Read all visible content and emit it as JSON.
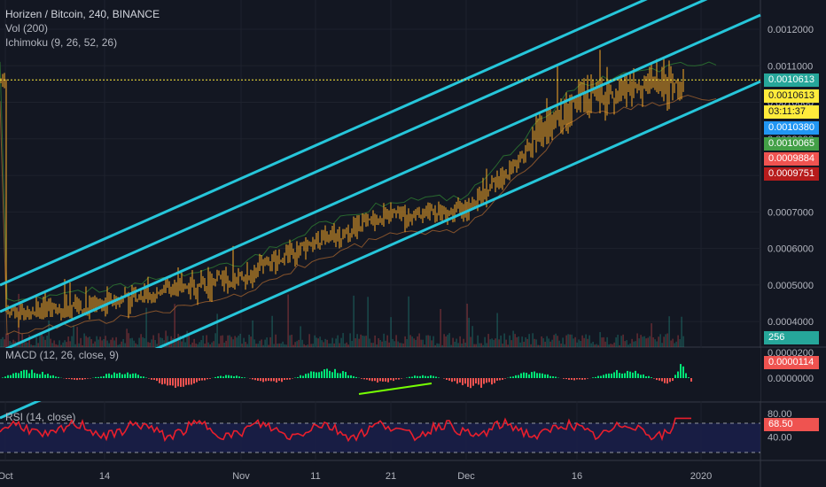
{
  "header": {
    "title": "Horizen / Bitcoin, 240, BINANCE",
    "volume_label": "Vol (200)",
    "ichimoku_label": "Ichimoku (9, 26, 52, 26)",
    "macd_label": "MACD (12, 26, close, 9)",
    "rsi_label": "RSI (14, close)"
  },
  "colors": {
    "background": "#131722",
    "channel_lines": "#26c6da",
    "candles": "#f9a825",
    "macd_up": "#26a69a",
    "macd_down": "#ef5350",
    "rsi_line": "#e91e2c",
    "trend_arrow": "#76ff03"
  },
  "price_tags": [
    {
      "text": "0.0010613",
      "bg": "#26a69a",
      "dark": false
    },
    {
      "text": "0.0010613",
      "bg": "#ffeb3b",
      "dark": true
    },
    {
      "text": "03:11:37",
      "bg": "#ffeb3b",
      "dark": true
    },
    {
      "text": "0.0010380",
      "bg": "#2196f3",
      "dark": false
    },
    {
      "text": "0.0010065",
      "bg": "#43a047",
      "dark": false
    },
    {
      "text": "0.0009884",
      "bg": "#ef5350",
      "dark": false
    },
    {
      "text": "0.0009751",
      "bg": "#b71c1c",
      "dark": false
    }
  ],
  "volume_tag": {
    "text": "256",
    "bg": "#26a69a"
  },
  "macd_tags": [
    {
      "text": "0.0000114",
      "bg": "#ef5350"
    }
  ],
  "rsi_tags": [
    {
      "text": "68.50",
      "bg": "#ef5350"
    }
  ],
  "chart_data": [
    {
      "type": "candlestick",
      "title": "Horizen / Bitcoin, 240, BINANCE",
      "y_ticks": [
        "0.0012000",
        "0.0011000",
        "0.0010000",
        "0.0009000",
        "0.0008000",
        "0.0007000",
        "0.0006000",
        "0.0005000",
        "0.0004000"
      ],
      "x_ticks": [
        "Oct",
        "14",
        "Nov",
        "11",
        "21",
        "Dec",
        "16",
        "2020"
      ],
      "ylim": [
        0.00033,
        0.00128
      ],
      "close_approx": [
        {
          "x": "Oct",
          "y": 0.00042
        },
        {
          "x": "14",
          "y": 0.00045
        },
        {
          "x": "Nov",
          "y": 0.00052
        },
        {
          "x": "11",
          "y": 0.00062
        },
        {
          "x": "21",
          "y": 0.00069
        },
        {
          "x": "Dec",
          "y": 0.0007
        },
        {
          "x": "16",
          "y": 0.00101
        },
        {
          "x": "2020",
          "y": 0.0010613
        }
      ],
      "last_price": 0.0010613,
      "channel_lines": 4,
      "indicators": [
        "Vol (200)",
        "Ichimoku (9, 26, 52, 26)"
      ]
    },
    {
      "type": "bar",
      "title": "MACD (12, 26, close, 9)",
      "y_ticks": [
        "0.0000200",
        "0.0000000"
      ],
      "last_value": 1.14e-05
    },
    {
      "type": "line",
      "title": "RSI (14, close)",
      "y_ticks": [
        "80.00",
        "40.00"
      ],
      "ylim": [
        0,
        100
      ],
      "overbought": 70,
      "oversold": 30,
      "last_value": 68.5
    }
  ]
}
